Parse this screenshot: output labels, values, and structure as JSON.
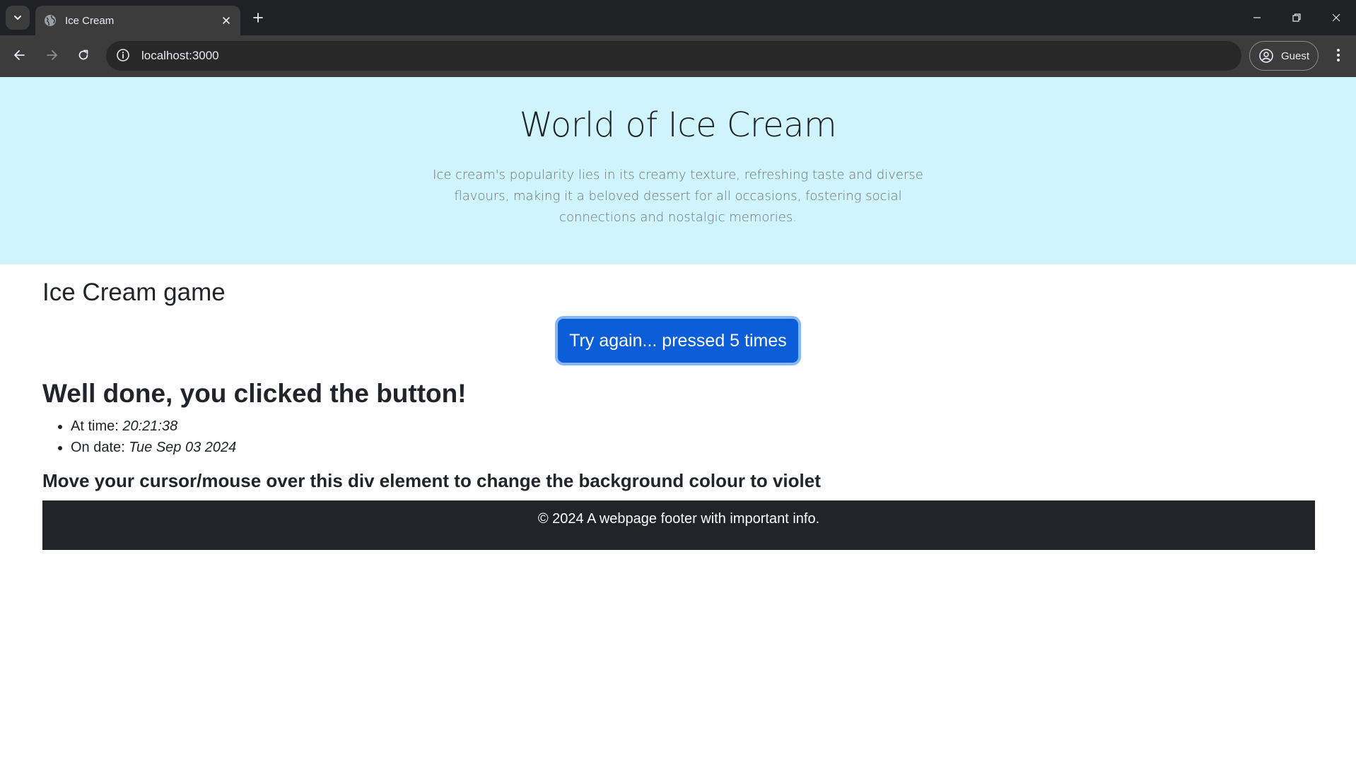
{
  "browser": {
    "tab_title": "Ice Cream",
    "url": "localhost:3000",
    "profile_label": "Guest"
  },
  "hero": {
    "title": "World of Ice Cream",
    "description": "Ice cream's popularity lies in its creamy texture, refreshing taste and diverse flavours, making it a beloved dessert for all occasions, fostering social connections and nostalgic memories."
  },
  "game": {
    "heading": "Ice Cream game",
    "button_label": "Try again... pressed 5 times",
    "result_heading": "Well done, you clicked the button!",
    "time_label": "At time:",
    "time_value": "20:21:38",
    "date_label": "On date:",
    "date_value": "Tue Sep 03 2024",
    "hover_text": "Move your cursor/mouse over this div element to change the background colour to violet"
  },
  "footer": {
    "text": "© 2024 A webpage footer with important info."
  },
  "colors": {
    "hero_bg": "#cff4fc",
    "button_bg": "#0b5ed7",
    "footer_bg": "#212529"
  }
}
